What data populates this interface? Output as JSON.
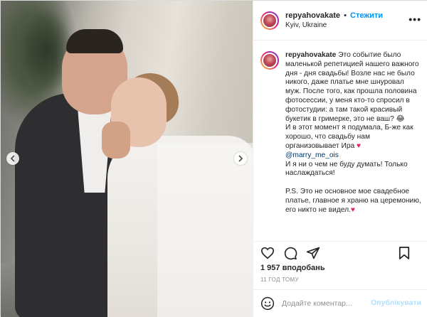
{
  "post": {
    "author": "repyahovakate",
    "separator": "•",
    "follow_label": "Стежити",
    "location": "Kyiv, Ukraine",
    "more_label": "•••"
  },
  "caption": {
    "author": "repyahovakate",
    "paragraphs": [
      "Это событие было маленькой репетицией нашего важного дня - дня свадьбы! Возле нас не было никого, даже платье мне шнуровал муж. После того, как прошла половина фотосессии, у меня кто-то спросил в фотостудии: а там такой красивый букетик в гримерке, это не ваш? 😂",
      "И в этот момент я подумала, Б-же как хорошо, что свадьбу нам организовывает Ира",
      "И я ни о чем не буду думать! Только наслаждаться!",
      "P.S. Это не основное мое свадебное платье, главное я храню на церемонию, его никто не видел."
    ],
    "mention": "@marry_me_ois",
    "heart": "♥"
  },
  "stats": {
    "likes": "1 957 вподобань",
    "time": "11 ГОД ТОМУ"
  },
  "comment": {
    "placeholder": "Додайте коментар...",
    "publish_label": "Опублікувати"
  },
  "icons": {
    "like": "heart-outline-icon",
    "comment": "comment-bubble-icon",
    "share": "paper-plane-icon",
    "save": "bookmark-icon",
    "emoji": "smiley-icon",
    "prev": "chevron-left-icon",
    "next": "chevron-right-icon"
  },
  "colors": {
    "follow": "#0095f6",
    "publish_disabled": "#b2dffc",
    "heart": "#e0245e"
  }
}
